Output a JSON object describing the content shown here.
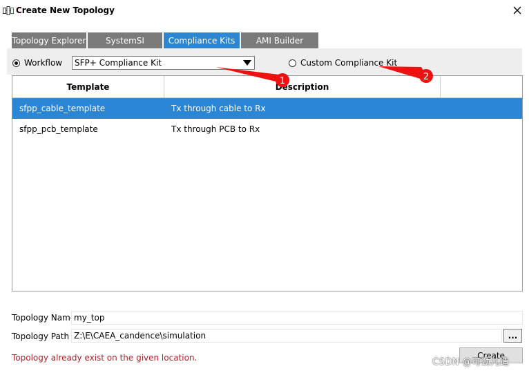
{
  "window": {
    "title": "Create New Topology",
    "close_glyph": "✕"
  },
  "tabs": [
    {
      "label": "Topology Explorer",
      "active": false
    },
    {
      "label": "SystemSI",
      "active": false
    },
    {
      "label": "Compliance Kits",
      "active": true
    },
    {
      "label": "AMI Builder",
      "active": false
    }
  ],
  "workflow": {
    "radio_label": "Workflow",
    "selected": true,
    "combo_value": "SFP+ Compliance Kit"
  },
  "custom_kit": {
    "radio_label": "Custom Compliance Kit",
    "selected": false
  },
  "table": {
    "columns": [
      "Template",
      "Description"
    ],
    "rows": [
      {
        "template": "sfpp_cable_template",
        "description": "Tx through cable to Rx",
        "selected": true
      },
      {
        "template": "sfpp_pcb_template",
        "description": "Tx through PCB to Rx",
        "selected": false
      }
    ]
  },
  "topology_name": {
    "label": "Topology Name",
    "value": "my_top"
  },
  "topology_path": {
    "label": "Topology Path",
    "value": "Z:\\E\\CAEA_candence\\simulation",
    "browse_label": "..."
  },
  "error_message": "Topology already exist on the given location.",
  "create_label": "Create",
  "annotations": [
    "1",
    "2"
  ],
  "watermark": "CSDN @可劲儿造",
  "colors": {
    "accent": "#2c86d2",
    "selection": "#2b86d6",
    "tab_inactive": "#7a7a7a",
    "error": "#b0222a",
    "annotation": "#ee1111"
  }
}
